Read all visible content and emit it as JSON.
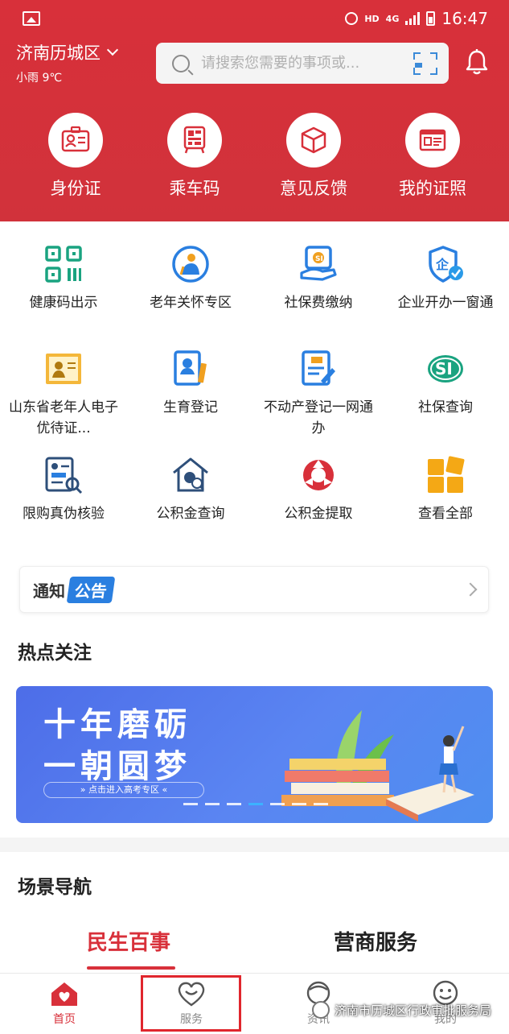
{
  "status_bar": {
    "hd": "HD",
    "network": "4G",
    "time": "16:47"
  },
  "header": {
    "city": "济南历城区",
    "weather": "小雨 9℃",
    "search_placeholder": "请搜索您需要的事项或..."
  },
  "quick_actions": [
    {
      "label": "身份证",
      "icon": "id-card-icon"
    },
    {
      "label": "乘车码",
      "icon": "bus-code-icon"
    },
    {
      "label": "意见反馈",
      "icon": "feedback-cube-icon"
    },
    {
      "label": "我的证照",
      "icon": "license-icon"
    }
  ],
  "services": [
    {
      "label": "健康码出示",
      "icon": "qr-code-icon"
    },
    {
      "label": "老年关怀专区",
      "icon": "elderly-care-icon"
    },
    {
      "label": "社保费缴纳",
      "icon": "social-security-pay-icon"
    },
    {
      "label": "企业开办一窗通",
      "icon": "enterprise-shield-icon"
    },
    {
      "label": "山东省老年人电子优待证...",
      "icon": "elderly-certificate-icon"
    },
    {
      "label": "生育登记",
      "icon": "birth-registration-icon"
    },
    {
      "label": "不动产登记一网通办",
      "icon": "real-estate-registration-icon"
    },
    {
      "label": "社保查询",
      "icon": "social-security-query-icon"
    },
    {
      "label": "限购真伪核验",
      "icon": "purchase-verify-icon"
    },
    {
      "label": "公积金查询",
      "icon": "housing-fund-query-icon"
    },
    {
      "label": "公积金提取",
      "icon": "housing-fund-withdraw-icon"
    },
    {
      "label": "查看全部",
      "icon": "view-all-icon"
    }
  ],
  "notice": {
    "label_a": "通知",
    "label_b": "公告"
  },
  "hot": {
    "title": "热点关注",
    "banner_line1": "十年磨砺",
    "banner_line2": "一朝圆梦",
    "banner_link": "» 点击进入高考专区 «"
  },
  "scene": {
    "title": "场景导航",
    "tabs": [
      "民生百事",
      "营商服务"
    ]
  },
  "tabbar": [
    {
      "label": "首页",
      "active": true
    },
    {
      "label": "服务",
      "active": false
    },
    {
      "label": "资讯",
      "active": false
    },
    {
      "label": "我的",
      "active": false
    }
  ],
  "watermark": "济南市历城区行政审批服务局",
  "colors": {
    "brand_red": "#d8303a",
    "accent_blue": "#2a7fe0",
    "highlight_box": "#e0262d"
  }
}
